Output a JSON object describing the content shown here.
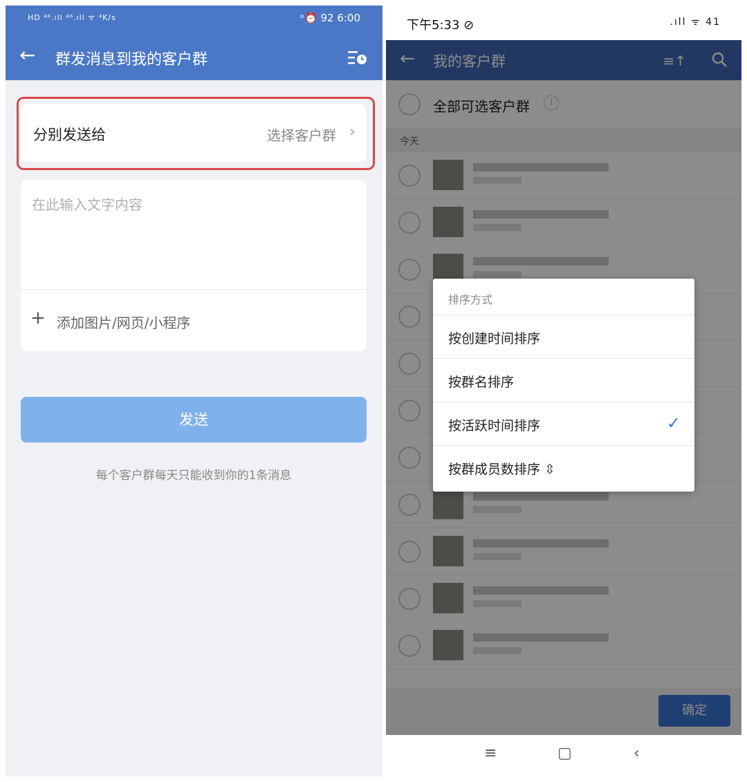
{
  "left": {
    "status": {
      "left": "HD ⁴⁶.ıll ⁴⁶.ıll ᯤ ⁴K/s",
      "right": "ᵒ⏰ 92 6:00"
    },
    "nav": {
      "back": "←",
      "title": "群发消息到我的客户群"
    },
    "send_to": {
      "label": "分别发送给",
      "value": "选择客户群",
      "chevron": "›"
    },
    "compose": {
      "placeholder": "在此输入文字内容",
      "plus": "+",
      "add_label": "添加图片/网页/小程序"
    },
    "send_button": "发送",
    "note": "每个客户群每天只能收到你的1条消息"
  },
  "right": {
    "status": {
      "time": "下午5:33 ⊘",
      "icons": ".ıll ᯤ 41"
    },
    "nav": {
      "back": "←",
      "title": "我的客户群",
      "sort": "≡↑"
    },
    "all": {
      "label": "全部可选客户群",
      "info": "i"
    },
    "section": "今天",
    "groups_count_note": "",
    "dialog": {
      "header": "排序方式",
      "options": [
        {
          "label": "按创建时间排序",
          "checked": false
        },
        {
          "label": "按群名排序",
          "checked": false
        },
        {
          "label": "按活跃时间排序",
          "checked": true
        },
        {
          "label": "按群成员数排序 ⇳",
          "checked": false
        }
      ],
      "check": "✓"
    },
    "ok_button": "确定",
    "sysnav": {
      "menu": "≡",
      "home": "▢",
      "back": "‹"
    }
  },
  "colors": {
    "left_bar": "#4a78c6",
    "right_bar": "#3d67b3",
    "highlight": "#d9484c",
    "send_disabled": "#7fb1ec",
    "check": "#3c78d8"
  }
}
